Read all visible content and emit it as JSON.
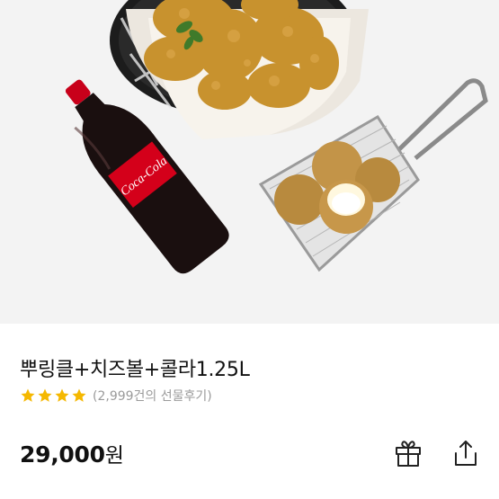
{
  "product": {
    "title": "뿌링클+치즈볼+콜라1.25L",
    "rating_stars": 4,
    "review_text": "(2,999건의 선물후기)",
    "price_amount": "29,000",
    "price_unit": "원",
    "bottle_label": "Coca-Cola"
  },
  "actions": {
    "gift_icon": "gift-icon",
    "share_icon": "share-icon"
  },
  "colors": {
    "star": "#f5b800",
    "hero_bg": "#f3f3f3",
    "coke_red": "#d4001a"
  }
}
